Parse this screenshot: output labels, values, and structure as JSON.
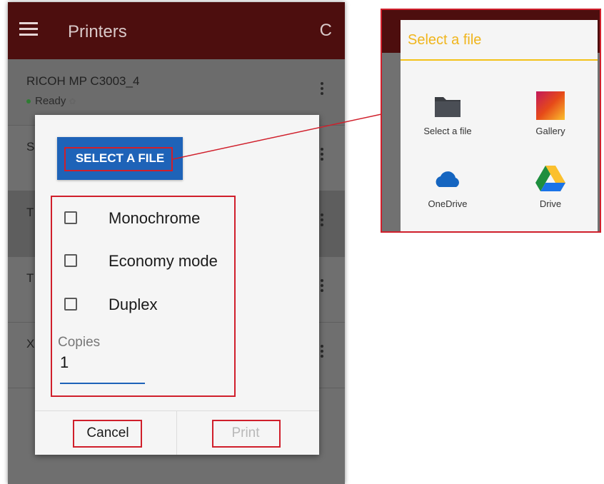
{
  "appbar": {
    "title": "Printers",
    "menu_icon": "menu-icon",
    "refresh_icon": "refresh-icon",
    "refresh_glyph": "C"
  },
  "printers": [
    {
      "name": "RICOH MP C3003_4",
      "status": "Ready",
      "status_icon": "palette-icon"
    },
    {
      "name": "S"
    },
    {
      "name": "T"
    },
    {
      "name": "T"
    },
    {
      "name": "X"
    }
  ],
  "dialog": {
    "select_button": "SELECT A FILE",
    "options": [
      {
        "label": "Monochrome",
        "checked": false
      },
      {
        "label": "Economy mode",
        "checked": false
      },
      {
        "label": "Duplex",
        "checked": false
      }
    ],
    "copies_label": "Copies",
    "copies_value": "1",
    "cancel_label": "Cancel",
    "print_label": "Print"
  },
  "picker": {
    "title": "Select a file",
    "items": [
      {
        "label": "Select a file",
        "icon": "folder-icon"
      },
      {
        "label": "Gallery",
        "icon": "gallery-icon"
      },
      {
        "label": "OneDrive",
        "icon": "onedrive-icon"
      },
      {
        "label": "Drive",
        "icon": "drive-icon"
      }
    ]
  },
  "colors": {
    "appbar": "#4d0e0e",
    "accent_blue": "#1e63b8",
    "highlight_red": "#d01f2b",
    "picker_title": "#f0b51c"
  }
}
